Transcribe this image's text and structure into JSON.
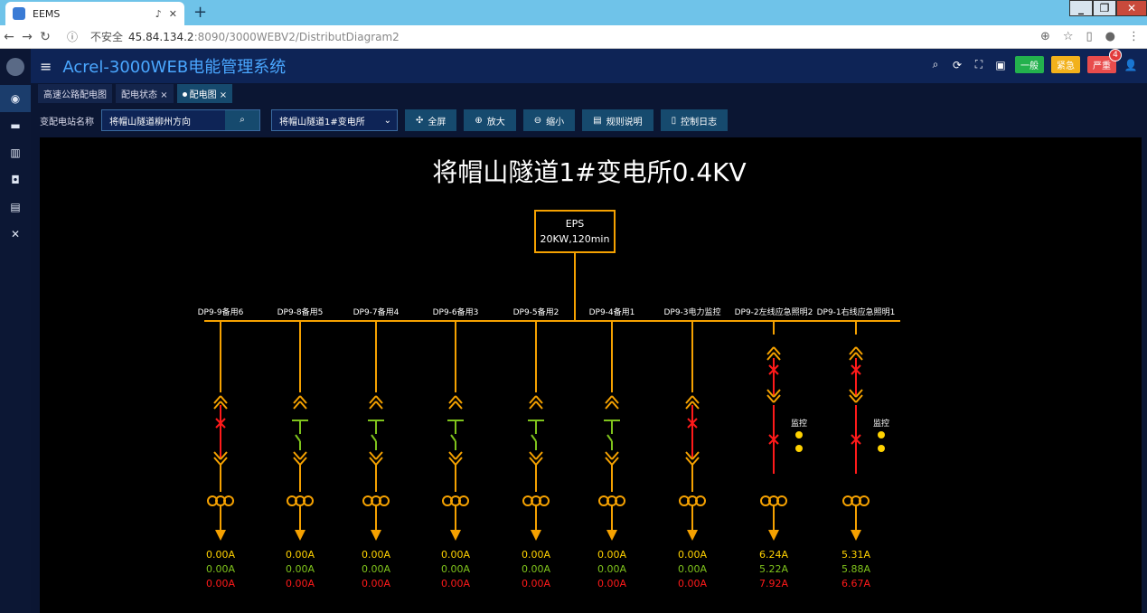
{
  "browser": {
    "tab_title": "EEMS",
    "url_label": "不安全",
    "url_host": "45.84.134.2",
    "url_rest": ":8090/3000WEBV2/DistributDiagram2"
  },
  "app": {
    "brand": "Acrel-3000WEB电能管理系统",
    "alarms": [
      {
        "label": "一般",
        "color": "#23b14d"
      },
      {
        "label": "紧急",
        "color": "#f2b11b"
      },
      {
        "label": "严重",
        "color": "#e84c4c",
        "badge": "4"
      }
    ]
  },
  "page_tabs": [
    {
      "label": "高速公路配电图",
      "active": false,
      "closable": false
    },
    {
      "label": "配电状态",
      "active": false,
      "closable": true
    },
    {
      "label": "配电图",
      "active": true,
      "closable": true
    }
  ],
  "toolbar": {
    "station_label": "变配电站名称",
    "station_value": "将帽山隧道柳州方向",
    "substation_value": "将帽山隧道1#变电所",
    "buttons": [
      "全屏",
      "放大",
      "缩小",
      "规则说明",
      "控制日志"
    ]
  },
  "diagram": {
    "title": "将帽山隧道1#变电所0.4KV",
    "eps_line1": "EPS",
    "eps_line2": "20KW,120min",
    "colors": {
      "bus": "#f5a100",
      "green": "#7fc31c",
      "red": "#ff1a1a",
      "yellow": "#ffd200"
    },
    "feeders": [
      {
        "name": "DP9-9备用6",
        "type": "tripped",
        "i1": "0.00A",
        "i2": "0.00A",
        "i3": "0.00A"
      },
      {
        "name": "DP9-8备用5",
        "type": "open",
        "i1": "0.00A",
        "i2": "0.00A",
        "i3": "0.00A"
      },
      {
        "name": "DP9-7备用4",
        "type": "open",
        "i1": "0.00A",
        "i2": "0.00A",
        "i3": "0.00A"
      },
      {
        "name": "DP9-6备用3",
        "type": "open",
        "i1": "0.00A",
        "i2": "0.00A",
        "i3": "0.00A"
      },
      {
        "name": "DP9-5备用2",
        "type": "open",
        "i1": "0.00A",
        "i2": "0.00A",
        "i3": "0.00A"
      },
      {
        "name": "DP9-4备用1",
        "type": "open",
        "i1": "0.00A",
        "i2": "0.00A",
        "i3": "0.00A"
      },
      {
        "name": "DP9-3电力监控",
        "type": "tripped",
        "i1": "0.00A",
        "i2": "0.00A",
        "i3": "0.00A"
      },
      {
        "name": "DP9-2左线应急照明2",
        "type": "emergency",
        "i1": "6.24A",
        "i2": "5.22A",
        "i3": "7.92A",
        "tag": "监控"
      },
      {
        "name": "DP9-1右线应急照明1",
        "type": "emergency",
        "i1": "5.31A",
        "i2": "5.88A",
        "i3": "6.67A",
        "tag": "监控"
      }
    ]
  }
}
